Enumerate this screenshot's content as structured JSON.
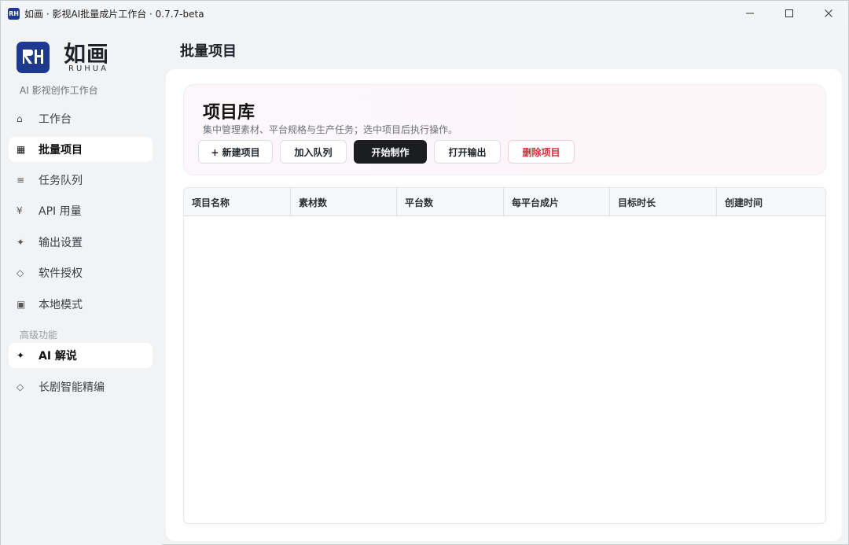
{
  "window": {
    "title": "如画 · 影视AI批量成片工作台 · 0.7.7-beta",
    "app_icon_text": "RH",
    "controls": {
      "minimize": "—",
      "maximize": "☐",
      "close": "✕"
    }
  },
  "sidebar": {
    "logo_text": "如画",
    "logo_sub": "RUHUA",
    "caption": "AI 影视创作工作台",
    "items": [
      {
        "icon": "⌂",
        "label": "工作台",
        "active": false
      },
      {
        "icon": "▦",
        "label": "批量项目",
        "active": true
      },
      {
        "icon": "≡",
        "label": "任务队列",
        "active": false
      },
      {
        "icon": "¥",
        "label": "API 用量",
        "active": false
      },
      {
        "icon": "✦",
        "label": "输出设置",
        "active": false
      },
      {
        "icon": "◇",
        "label": "软件授权",
        "active": false
      },
      {
        "icon": "▣",
        "label": "本地模式",
        "active": false
      }
    ],
    "section_label": "高级功能",
    "advanced_items": [
      {
        "icon": "✦",
        "label": "AI 解说",
        "active": true
      },
      {
        "icon": "◇",
        "label": "长剧智能精编",
        "active": false
      }
    ]
  },
  "main": {
    "page_title": "批量项目",
    "hero": {
      "title": "项目库",
      "description": "集中管理素材、平台规格与生产任务；选中项目后执行操作。",
      "buttons": {
        "new_project": "+ 新建项目",
        "add_queue": "加入队列",
        "start": "开始制作",
        "open_output": "打开输出",
        "delete": "删除项目"
      }
    },
    "table": {
      "columns": [
        "项目名称",
        "素材数",
        "平台数",
        "每平台成片",
        "目标时长",
        "创建时间"
      ],
      "rows": []
    }
  },
  "colors": {
    "brand": "#1d3a8f",
    "primary_button": "#1b1d21",
    "danger": "#c8333a"
  }
}
